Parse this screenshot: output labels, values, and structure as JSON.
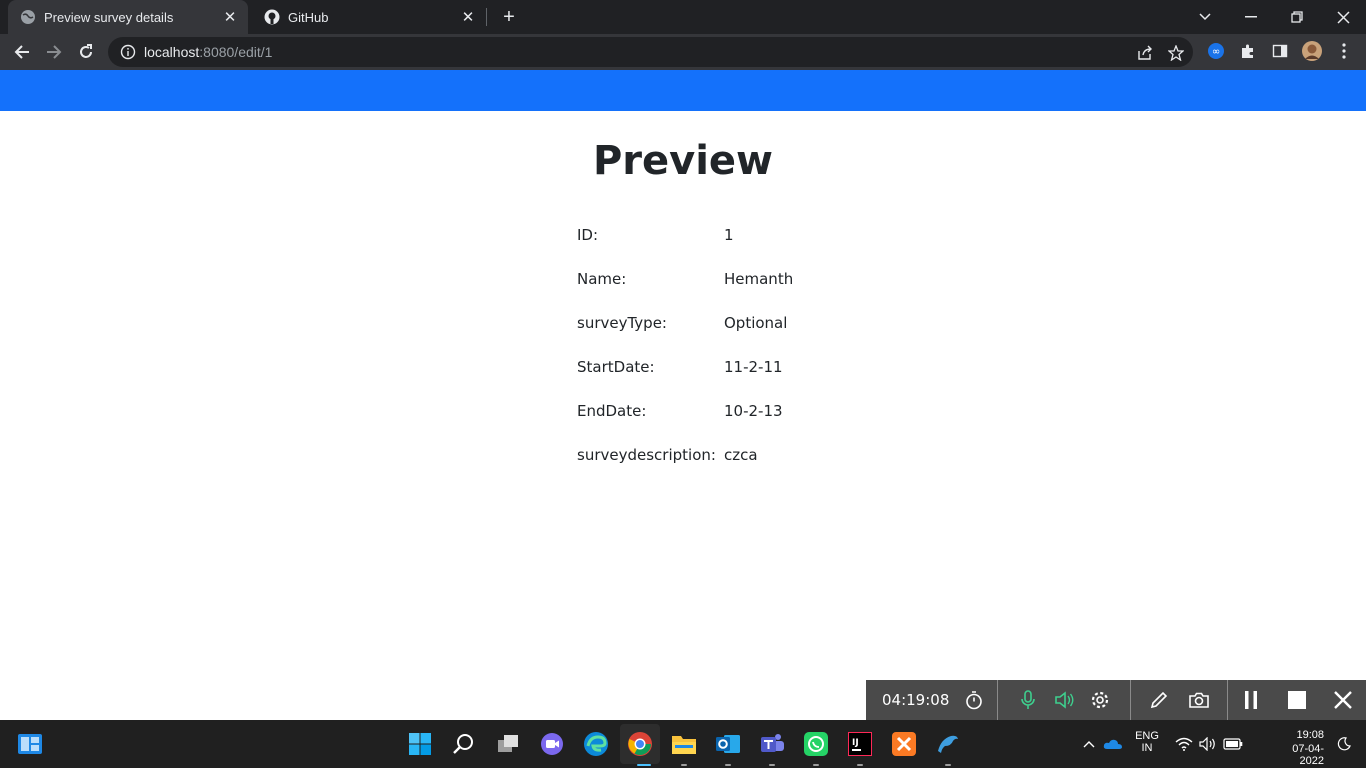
{
  "browser": {
    "tabs": [
      {
        "label": "Preview survey details"
      },
      {
        "label": "GitHub"
      }
    ],
    "url_host": "localhost",
    "url_rest": ":8080/edit/1"
  },
  "page": {
    "title": "Preview",
    "fields": [
      {
        "label": "ID:",
        "value": "1"
      },
      {
        "label": "Name:",
        "value": "Hemanth"
      },
      {
        "label": "surveyType:",
        "value": "Optional"
      },
      {
        "label": "StartDate:",
        "value": "11-2-11"
      },
      {
        "label": "EndDate:",
        "value": "10-2-13"
      },
      {
        "label": "surveydescription:",
        "value": "czca"
      }
    ]
  },
  "recorder": {
    "elapsed": "04:19:08"
  },
  "taskbar": {
    "lang_top": "ENG",
    "lang_bottom": "IN",
    "time": "19:08",
    "date": "07-04-2022"
  },
  "colors": {
    "header": "#1471fb",
    "chrome_dark": "#202124",
    "chrome_toolbar": "#35363a"
  }
}
